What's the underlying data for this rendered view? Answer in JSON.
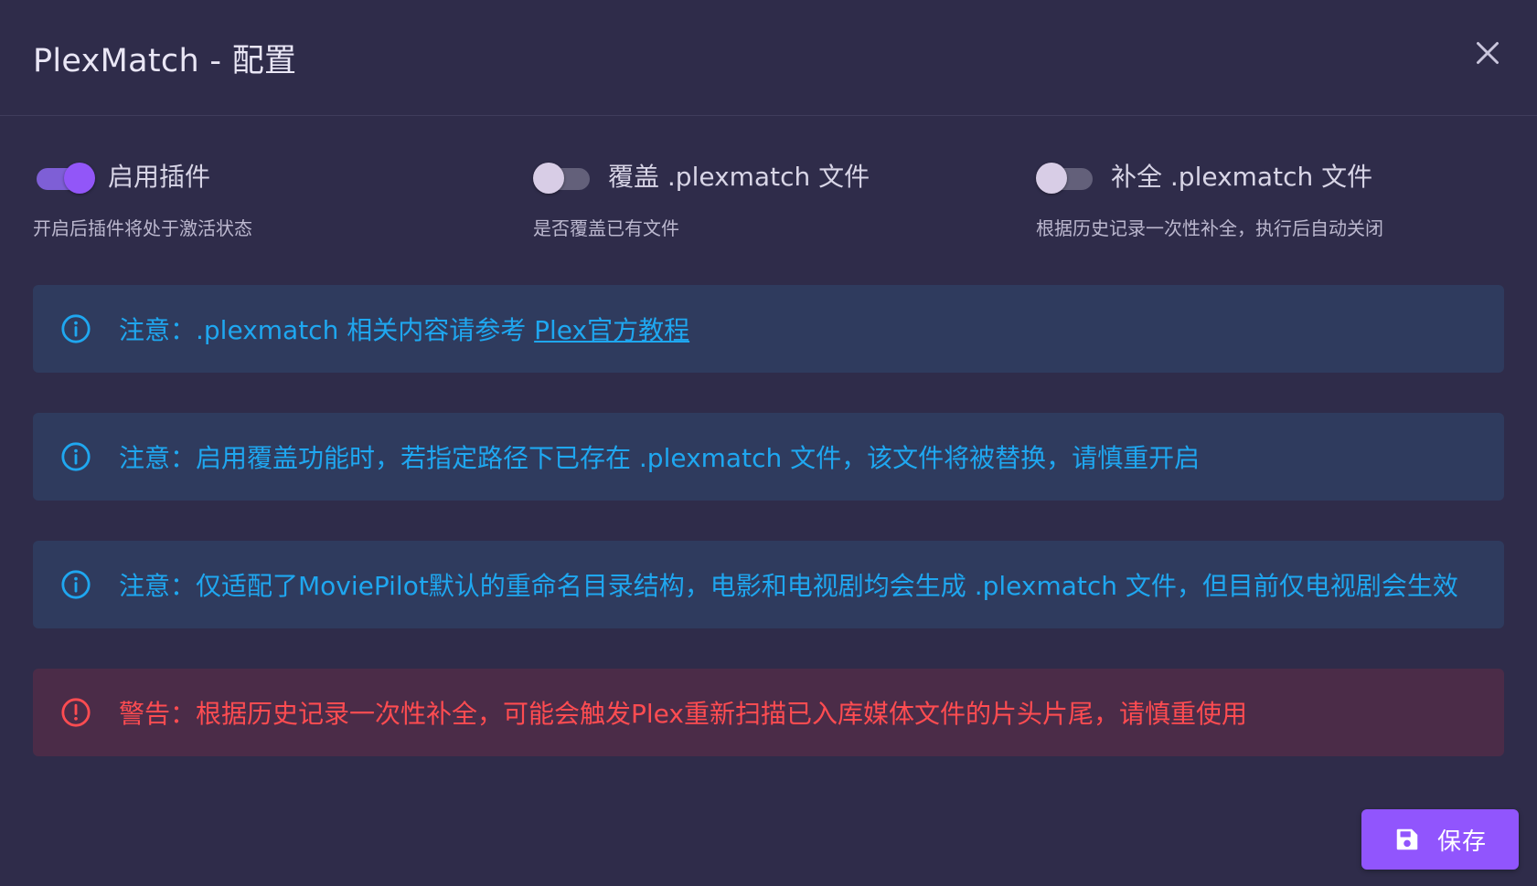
{
  "dialog": {
    "title": "PlexMatch - 配置",
    "close_icon": "close-icon"
  },
  "switches": [
    {
      "label": "启用插件",
      "hint": "开启后插件将处于激活状态",
      "checked": true
    },
    {
      "label": "覆盖 .plexmatch 文件",
      "hint": "是否覆盖已有文件",
      "checked": false
    },
    {
      "label": "补全 .plexmatch 文件",
      "hint": "根据历史记录一次性补全，执行后自动关闭",
      "checked": false
    }
  ],
  "alerts": [
    {
      "type": "info",
      "icon": "info-icon",
      "text": "注意：.plexmatch 相关内容请参考 ",
      "link_text": "Plex官方教程"
    },
    {
      "type": "info",
      "icon": "info-icon",
      "text": "注意：启用覆盖功能时，若指定路径下已存在 .plexmatch 文件，该文件将被替换，请慎重开启"
    },
    {
      "type": "info",
      "icon": "info-icon",
      "text": "注意：仅适配了MoviePilot默认的重命名目录结构，电影和电视剧均会生成 .plexmatch 文件，但目前仅电视剧会生效"
    },
    {
      "type": "error",
      "icon": "alert-circle-icon",
      "text": "警告：根据历史记录一次性补全，可能会触发Plex重新扫描已入库媒体文件的片头片尾，请慎重使用"
    }
  ],
  "actions": {
    "save_label": "保存",
    "save_icon": "floppy-disk-icon"
  },
  "colors": {
    "accent": "#9155fd",
    "info": "#1fa7f0",
    "error": "#ff4c51",
    "background": "#2f2c4a"
  }
}
